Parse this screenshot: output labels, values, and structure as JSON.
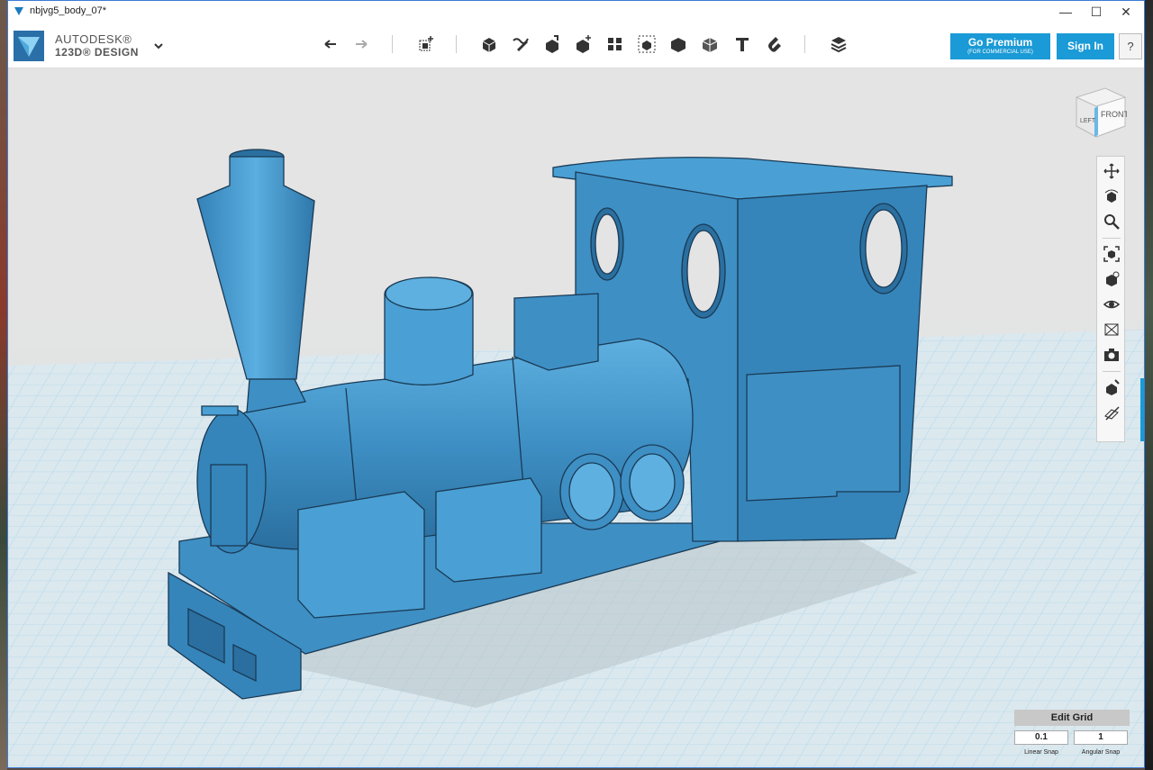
{
  "window": {
    "title": "nbjvg5_body_07*",
    "controls": {
      "minimize": "—",
      "maximize": "☐",
      "close": "✕"
    }
  },
  "brand": {
    "line1": "AUTODESK®",
    "line2": "123D® DESIGN"
  },
  "toolbar": {
    "tools": [
      "undo-icon",
      "redo-icon",
      "transform-icon",
      "primitives-icon",
      "sketch-icon",
      "construct-icon",
      "modify-icon",
      "pattern-icon",
      "group-icon",
      "combine-icon",
      "measure-icon",
      "text-icon",
      "snap-icon",
      "materials-icon"
    ]
  },
  "buttons": {
    "premium_label": "Go Premium",
    "premium_sub": "(FOR COMMERCIAL USE)",
    "signin_label": "Sign In",
    "help_label": "?"
  },
  "viewcube": {
    "left": "LEFT",
    "front": "FRONT"
  },
  "nav": {
    "items": [
      "pan-icon",
      "orbit-icon",
      "zoom-icon",
      "fit-icon",
      "view-mode-icon",
      "visibility-icon",
      "material-view-icon",
      "camera-icon",
      "snap-view-icon",
      "grid-icon"
    ]
  },
  "edit_grid": {
    "title": "Edit Grid",
    "linear_value": "0.1",
    "angular_value": "1",
    "linear_label": "Linear Snap",
    "angular_label": "Angular Snap"
  },
  "colors": {
    "accent": "#1a9ad6",
    "model": "#3e8fc4",
    "grid": "#9fd0e8"
  }
}
